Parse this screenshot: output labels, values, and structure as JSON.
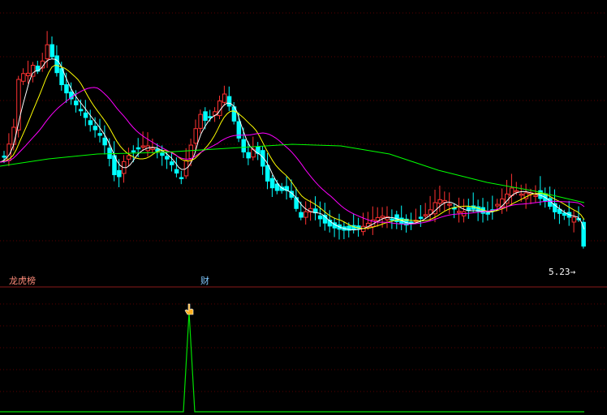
{
  "chart_data": [
    {
      "type": "candlestick",
      "title": "",
      "grid": true,
      "colors": {
        "up": "#ff3232",
        "down": "#00ffff",
        "ma5": "#ffffff",
        "ma10": "#ffff00",
        "ma20": "#ff00ff",
        "ma60": "#00ff00"
      },
      "series": [
        {
          "name": "",
          "color": "#ffffff",
          "values": []
        },
        {
          "name": "",
          "color": "#ffff00",
          "values": []
        },
        {
          "name": "",
          "color": "#ff00ff",
          "values": []
        },
        {
          "name": "",
          "color": "#00ff00",
          "values": []
        }
      ],
      "annotations": {
        "last_low_price": "5.23",
        "markers": [
          "龙虎榜",
          "财"
        ]
      }
    },
    {
      "type": "line",
      "title": "",
      "grid": true,
      "series": [
        {
          "name": "",
          "color": "#00e000",
          "spike_index": 87
        }
      ]
    }
  ],
  "labels": {
    "tag_longhu": "龙虎榜",
    "tag_cai": "财",
    "price": "5.23",
    "price_arrow": "→"
  }
}
